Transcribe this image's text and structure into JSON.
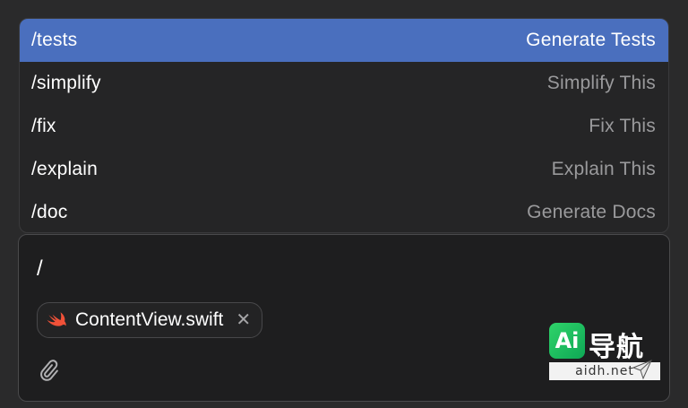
{
  "commands": [
    {
      "name": "/tests",
      "description": "Generate Tests",
      "selected": true
    },
    {
      "name": "/simplify",
      "description": "Simplify This",
      "selected": false
    },
    {
      "name": "/fix",
      "description": "Fix This",
      "selected": false
    },
    {
      "name": "/explain",
      "description": "Explain This",
      "selected": false
    },
    {
      "name": "/doc",
      "description": "Generate Docs",
      "selected": false
    }
  ],
  "composer": {
    "input_value": "/",
    "attachment": {
      "file_name": "ContentView.swift",
      "icon": "swift-icon",
      "remove_icon": "close-icon"
    },
    "attach_icon": "paperclip-icon"
  },
  "watermark": {
    "logo_text": "Ai",
    "brand_text": "导航",
    "domain": "aidh.net"
  },
  "colors": {
    "selected_row": "#4a6fbe",
    "swift_orange": "#f05138",
    "watermark_green": "#1fc060"
  }
}
